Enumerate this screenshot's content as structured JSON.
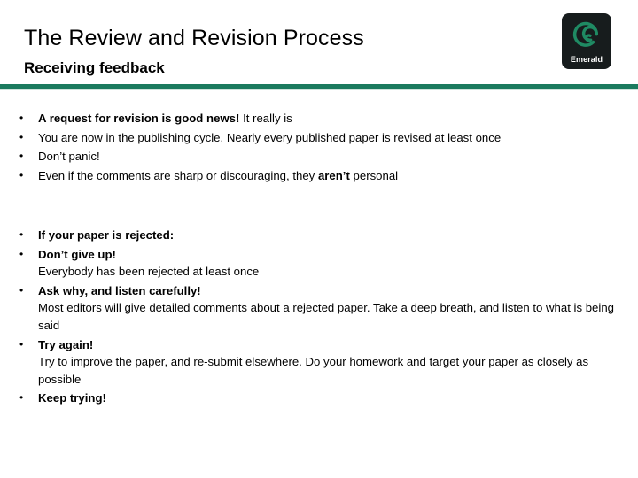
{
  "slide": {
    "title": "The Review and Revision Process",
    "subtitle": "Receiving feedback",
    "accent_color": "#1b7a5e",
    "logo": {
      "wordmark": "Emerald",
      "mark_color": "#1f8a63",
      "background_color": "#171c1d"
    },
    "blocks": [
      {
        "id": "block-one",
        "bullets": [
          {
            "marker": "•",
            "lead": "A request for revision is good news!",
            "lead_bold": true,
            "trailing": " It really is",
            "sub": ""
          },
          {
            "marker": "•",
            "lead": "You are now in the publishing cycle. Nearly every published paper is revised at least once",
            "lead_bold": false,
            "trailing": "",
            "sub": ""
          },
          {
            "marker": "•",
            "lead": "Don’t panic!",
            "lead_bold": false,
            "trailing": "",
            "sub": ""
          },
          {
            "marker": "•",
            "lead": "Even if the comments are sharp or discouraging, they ",
            "lead_bold": false,
            "bold_inline": "aren’t",
            "trailing": " personal",
            "sub": ""
          }
        ]
      },
      {
        "id": "block-two",
        "bullets": [
          {
            "marker": "•",
            "lead": "If your paper is rejected:",
            "lead_bold": true,
            "trailing": "",
            "sub": ""
          },
          {
            "marker": "•",
            "lead": "Don’t give up!",
            "lead_bold": true,
            "trailing": "",
            "sub": "Everybody has been rejected at least once"
          },
          {
            "marker": "•",
            "lead": "Ask why, and listen carefully!",
            "lead_bold": true,
            "trailing": "",
            "sub": "Most editors will give detailed comments about a rejected paper. Take a deep breath, and listen to what is being said"
          },
          {
            "marker": "•",
            "lead": "Try again!",
            "lead_bold": true,
            "trailing": "",
            "sub": "Try to improve the paper, and re-submit elsewhere. Do your homework and target your paper as closely as possible"
          },
          {
            "marker": "•",
            "lead": "Keep trying!",
            "lead_bold": true,
            "trailing": "",
            "sub": ""
          }
        ]
      }
    ]
  }
}
